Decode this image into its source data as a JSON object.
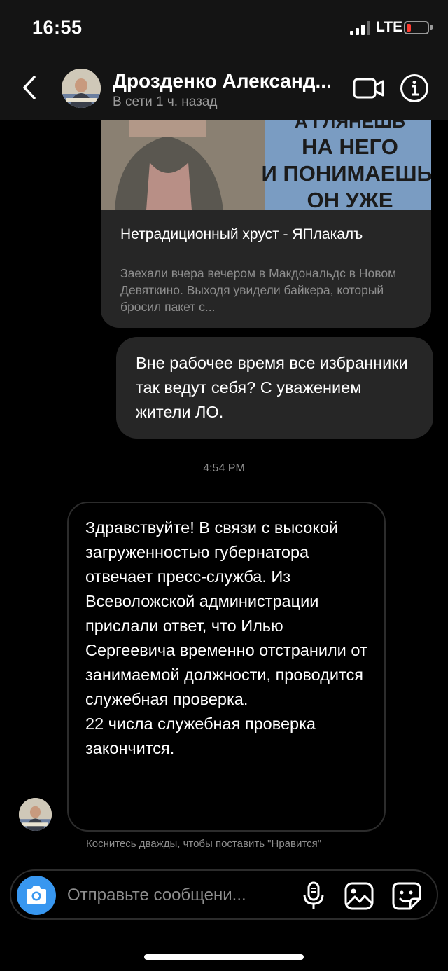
{
  "status_bar": {
    "time": "16:55",
    "network": "LTE",
    "battery_color": "#ff3b30",
    "battery_level_fraction": 0.2
  },
  "header": {
    "contact_name": "Дрозденко Александ...",
    "contact_status": "В сети 1 ч. назад",
    "icons": [
      "chevron-left-icon",
      "video-camera-icon",
      "info-icon"
    ]
  },
  "link_preview": {
    "image_text_lines": [
      "А ГЛЯНЕШЬ",
      "НА НЕГО",
      "И ПОНИМАЕШЬ.",
      "ОН УЖЕ"
    ],
    "title": "Нетрадиционный хруст - ЯПлакалъ",
    "description": "Заехали вчера вечером в Макдональдс в Новом Девяткино. Выходя увидели байкера, который бросил пакет с..."
  },
  "messages": [
    {
      "direction": "sent",
      "text": "Вне рабочее время все избранники так ведут себя? С уважением жители ЛО."
    },
    {
      "direction": "received",
      "timestamp": "4:54 PM",
      "paragraphs": [
        "Здравствуйте! В связи с высокой загруженностью губернатора отвечает пресс-служба. Из Всеволожской администрации прислали ответ, что Илью Сергеевича временно отстранили от занимаемой должности, проводится служебная проверка.",
        "22 числа служебная проверка закончится."
      ]
    }
  ],
  "hint": "Коснитесь дважды, чтобы поставить \"Нравится\"",
  "composer": {
    "placeholder": "Отправьте сообщени...",
    "camera_button_color": "#3897f0",
    "icons": [
      "camera-icon",
      "microphone-icon",
      "gallery-icon",
      "sticker-icon"
    ]
  }
}
